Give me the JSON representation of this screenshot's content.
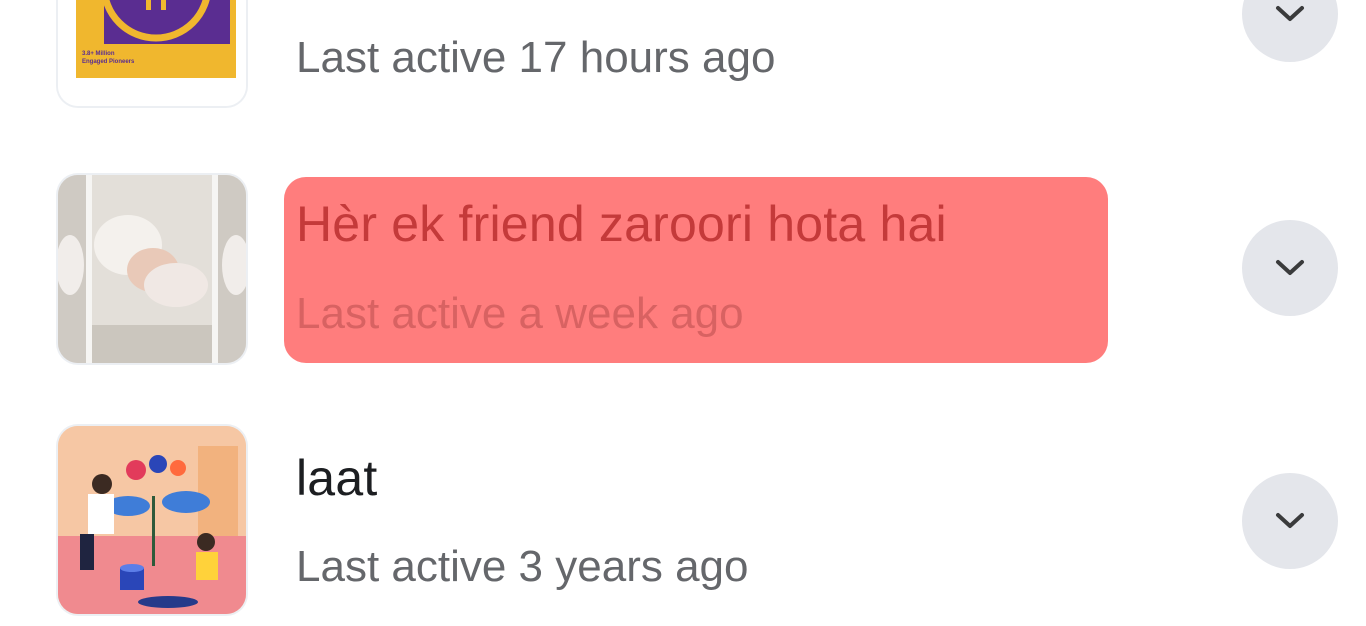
{
  "groups": [
    {
      "title": "",
      "last_active": "Last active 17 hours ago",
      "thumb_text": [
        "3.8+ Million",
        "Engaged Pioneers"
      ],
      "thumb_icon": "pi-coin-icon",
      "highlighted": false
    },
    {
      "title": "Hèr ek friend zaroori hota hai",
      "last_active": "Last active a week ago",
      "thumb_icon": "baby-photo",
      "highlighted": true,
      "highlight_color": "#ff7d7d"
    },
    {
      "title": "laat",
      "last_active": "Last active 3 years ago",
      "thumb_icon": "gardening-illustration",
      "highlighted": false
    }
  ],
  "more_button_icon": "chevron-down-icon",
  "colors": {
    "title": "#1c1e21",
    "subtitle": "#65676b",
    "button_bg": "#e4e6eb",
    "highlight": "#ff7d7d"
  }
}
